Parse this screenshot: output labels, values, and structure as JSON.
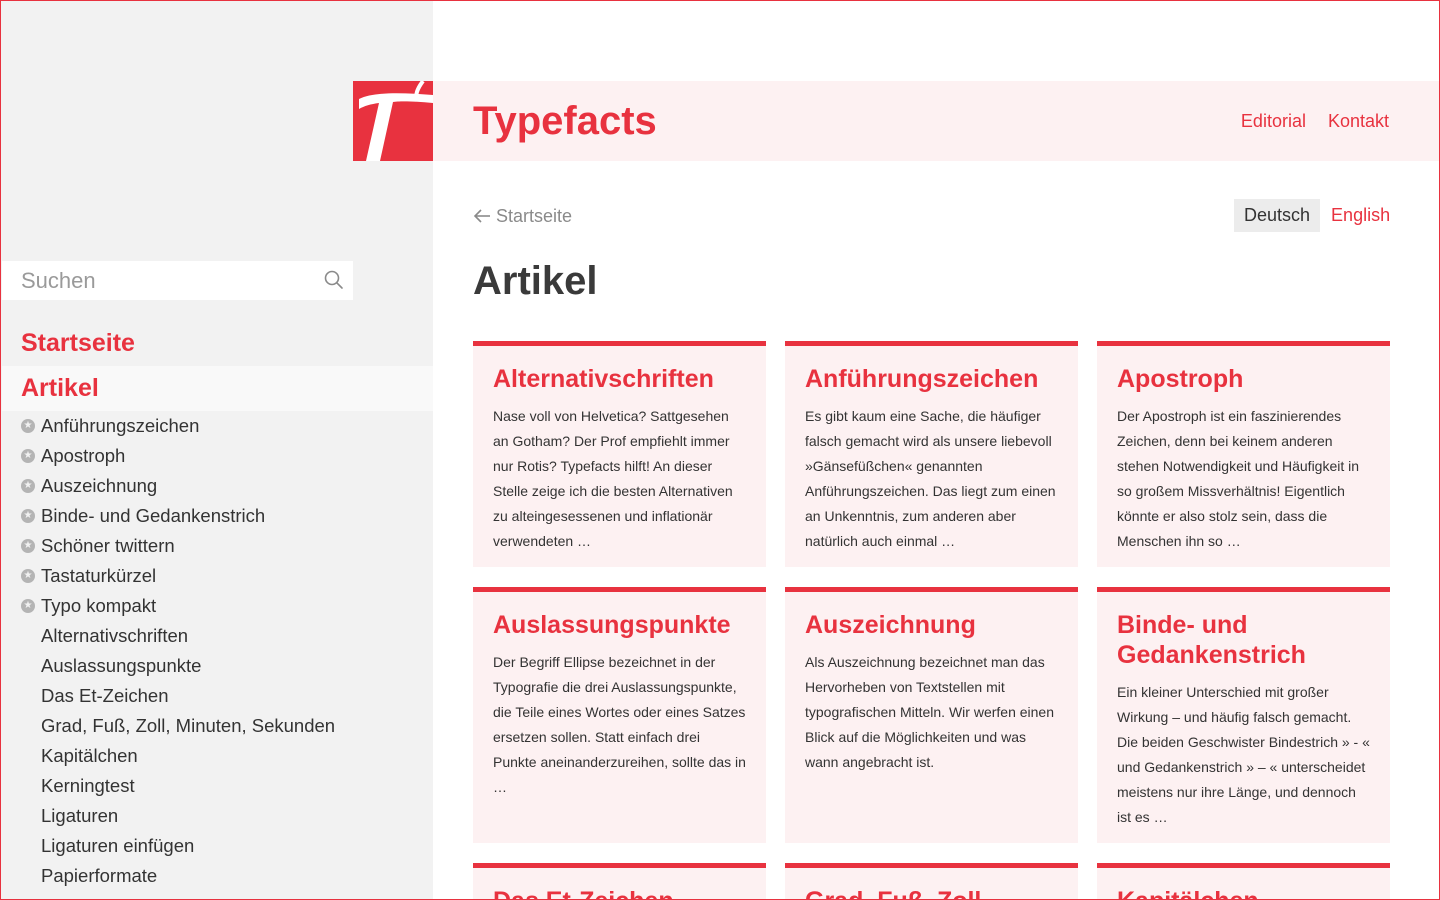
{
  "colors": {
    "accent": "#e8323f",
    "header_bg": "#fdf1f2",
    "sidebar_bg": "#f2f2f2"
  },
  "sidebar": {
    "search": {
      "placeholder": "Suchen",
      "icon": "search-icon"
    },
    "nav_home": "Startseite",
    "nav_active": "Artikel",
    "starred": [
      "Anführungszeichen",
      "Apostroph",
      "Auszeichnung",
      "Binde- und Gedankenstrich",
      "Schöner twittern",
      "Tastaturkürzel",
      "Typo kompakt"
    ],
    "items": [
      "Alternativschriften",
      "Auslassungspunkte",
      "Das Et-Zeichen",
      "Grad, Fuß, Zoll, Minuten, Sekunden",
      "Kapitälchen",
      "Kerningtest",
      "Ligaturen",
      "Ligaturen einfügen",
      "Papierformate"
    ]
  },
  "header": {
    "brand": "Typefacts",
    "links": [
      "Editorial",
      "Kontakt"
    ]
  },
  "content": {
    "back_label": "Startseite",
    "languages": {
      "active": "Deutsch",
      "other": "English"
    },
    "title": "Artikel",
    "cards": [
      {
        "title": "Alternativschriften",
        "excerpt": "Nase voll von Helvetica? Sattgesehen an Gotham? Der Prof empfiehlt immer nur Rotis? Typefacts hilft! An dieser Stelle zeige ich die besten Alternativen zu alteingesessenen und inflationär verwendeten …"
      },
      {
        "title": "Anführungszeichen",
        "excerpt": "Es gibt kaum eine Sache, die häufiger falsch gemacht wird als unsere liebevoll »Gänsefüßchen« genannten Anführungszeichen. Das liegt zum einen an Unkenntnis, zum anderen aber natürlich auch einmal …"
      },
      {
        "title": "Apostroph",
        "excerpt": "Der Apostroph ist ein faszinierendes Zeichen, denn bei keinem anderen stehen Notwendigkeit und Häufigkeit in so großem Missverhältnis! Eigentlich könnte er also stolz sein, dass die Menschen ihn so …"
      },
      {
        "title": "Auslassungspunkte",
        "excerpt": "Der Begriff Ellipse bezeichnet in der Typografie die drei Auslassungspunkte, die Teile eines Wortes oder eines Satzes ersetzen sollen. Statt einfach drei Punkte aneinanderzureihen, sollte das in …"
      },
      {
        "title": "Auszeichnung",
        "excerpt": "Als Auszeichnung bezeichnet man das Hervorheben von Textstellen mit typografischen Mitteln. Wir werfen einen Blick auf die Möglichkeiten und was wann angebracht ist."
      },
      {
        "title": "Binde- und Gedankenstrich",
        "excerpt": "Ein kleiner Unterschied mit großer Wirkung – und häufig falsch gemacht. Die beiden Geschwister Bindestrich » - « und Gedankenstrich » – « unterscheidet meistens nur ihre Länge, und dennoch ist es …"
      },
      {
        "title": "Das Et-Zeichen",
        "excerpt": ""
      },
      {
        "title": "Grad, Fuß, Zoll",
        "excerpt": ""
      },
      {
        "title": "Kapitälchen",
        "excerpt": ""
      }
    ]
  }
}
